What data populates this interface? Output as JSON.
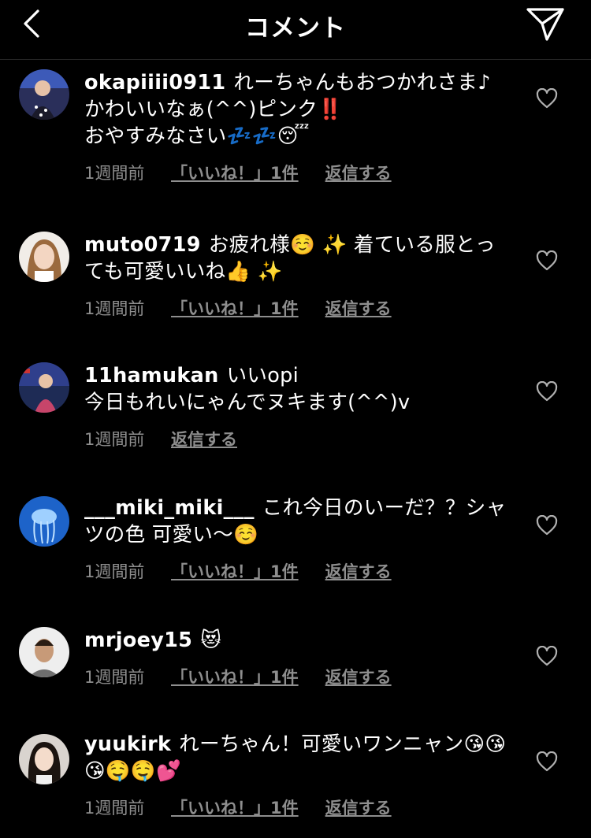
{
  "header": {
    "title": "コメント",
    "back_icon": "chevron-left-icon",
    "send_icon": "paper-plane-icon"
  },
  "comments": [
    {
      "username": "okapiiii0911",
      "text": "れーちゃんもおつかれさま♪\nかわいいなぁ(^^)ピンク‼️\nおやすみなさい💤💤😴",
      "time": "1週間前",
      "likes": "「いいね！」1件",
      "reply": "返信する"
    },
    {
      "username": "muto0719",
      "text": "お疲れ様☺️ ✨ 着ている服とっても可愛いいね👍 ✨",
      "time": "1週間前",
      "likes": "「いいね！」1件",
      "reply": "返信する"
    },
    {
      "username": "11hamukan",
      "text": "いいopi\n今日もれいにゃんでヌキます(^^)v",
      "time": "1週間前",
      "likes": "",
      "reply": "返信する"
    },
    {
      "username": "___miki_miki___",
      "text": "これ今日のいーだ？？シャツの色 可愛い〜☺️",
      "time": "1週間前",
      "likes": "「いいね！」1件",
      "reply": "返信する"
    },
    {
      "username": "mrjoey15",
      "text": "😻",
      "time": "1週間前",
      "likes": "「いいね！」1件",
      "reply": "返信する"
    },
    {
      "username": "yuukirk",
      "text": "れーちゃん！可愛いワンニャン😘😘😘🤤🤤💕",
      "time": "1週間前",
      "likes": "「いいね！」1件",
      "reply": "返信する"
    }
  ]
}
